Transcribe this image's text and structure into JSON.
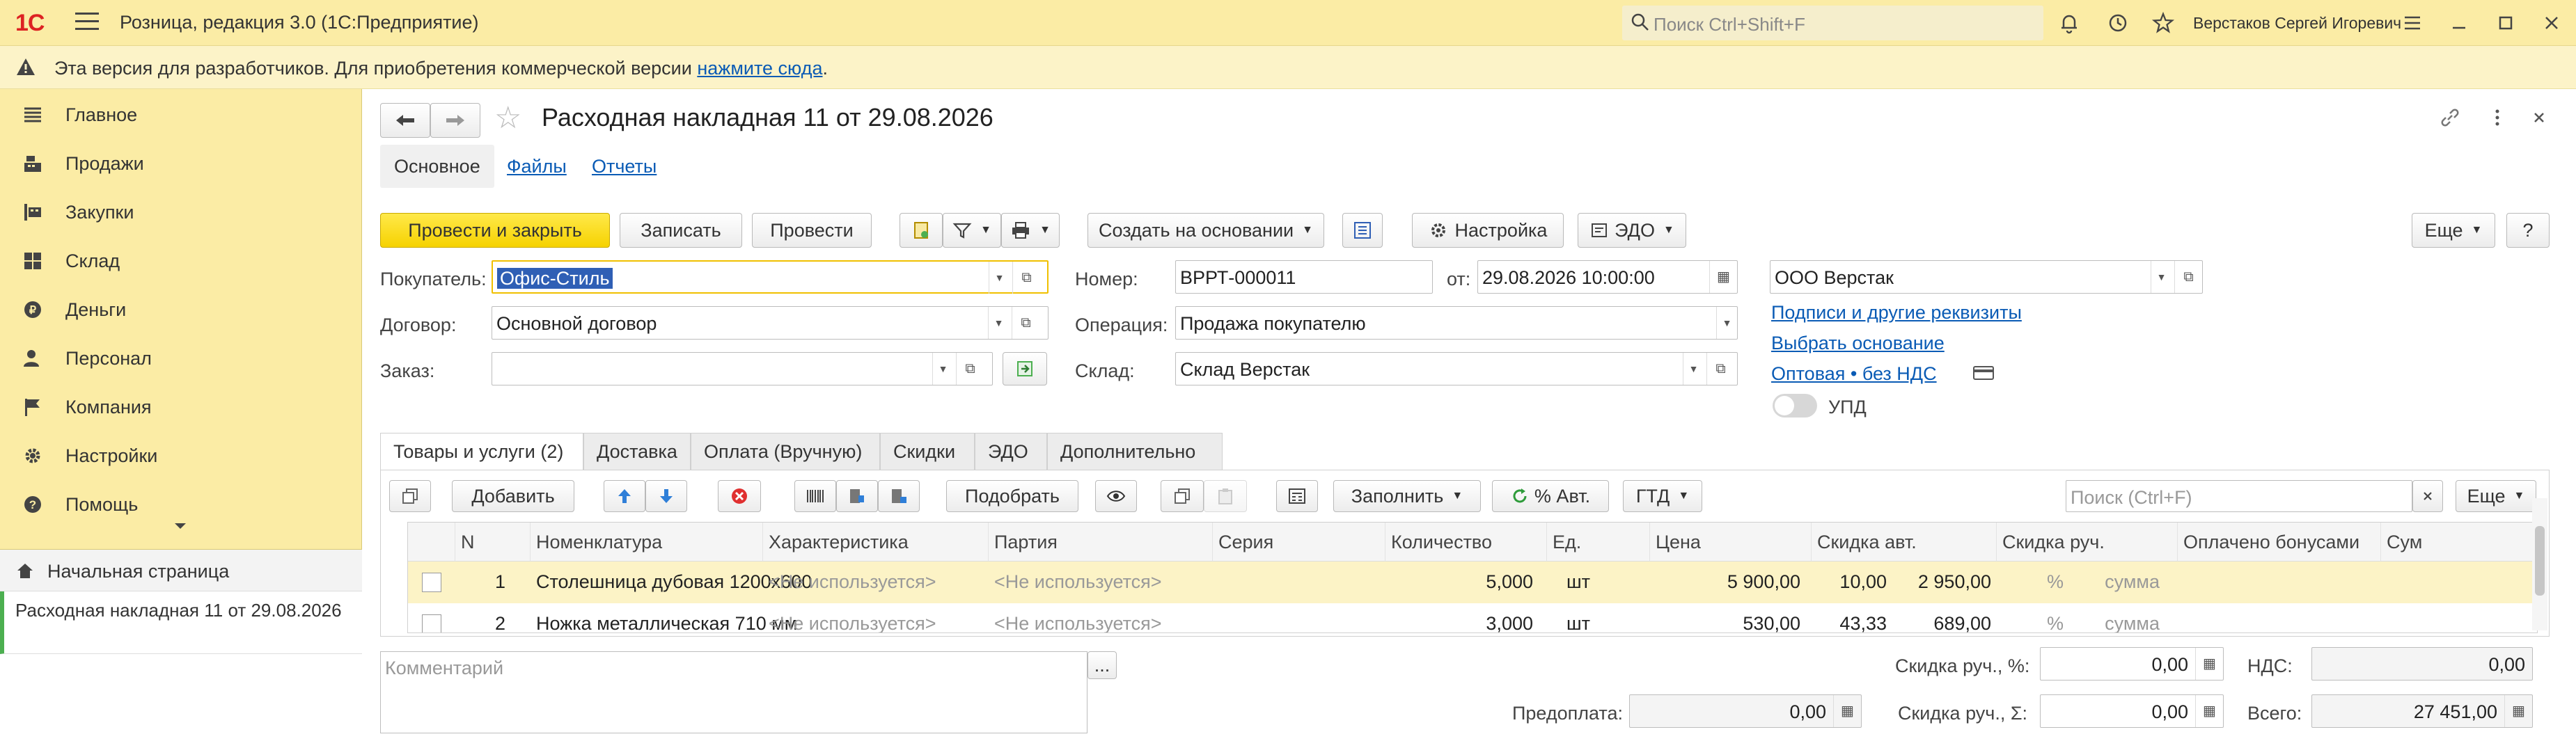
{
  "titlebar": {
    "logo": "1С",
    "app_title": "Розница, редакция 3.0  (1С:Предприятие)",
    "search_placeholder": "Поиск Ctrl+Shift+F",
    "user": "Верстаков Сергей Игоревич"
  },
  "infobar": {
    "text": "Эта версия для разработчиков. Для приобретения коммерческой версии ",
    "link": "нажмите сюда",
    "after": "."
  },
  "sidebar": {
    "items": [
      {
        "label": "Главное",
        "icon": "list-icon"
      },
      {
        "label": "Продажи",
        "icon": "cash-register-icon"
      },
      {
        "label": "Закупки",
        "icon": "cart-icon"
      },
      {
        "label": "Склад",
        "icon": "warehouse-icon"
      },
      {
        "label": "Деньги",
        "icon": "coin-icon"
      },
      {
        "label": "Персонал",
        "icon": "person-icon"
      },
      {
        "label": "Компания",
        "icon": "flag-icon"
      },
      {
        "label": "Настройки",
        "icon": "gear-icon"
      },
      {
        "label": "Помощь",
        "icon": "help-icon"
      }
    ],
    "home": "Начальная страница",
    "open_doc": "Расходная накладная 11 от 29.08.2026"
  },
  "doc": {
    "title": "Расходная накладная 11 от 29.08.2026",
    "tabs": [
      "Основное",
      "Файлы",
      "Отчеты"
    ]
  },
  "toolbar": {
    "post_close": "Провести и закрыть",
    "save": "Записать",
    "post": "Провести",
    "create_based": "Создать на основании",
    "settings": "Настройка",
    "edo": "ЭДО",
    "more": "Еще",
    "help": "?"
  },
  "form": {
    "buyer_label": "Покупатель:",
    "buyer_value": "Офис-Стиль",
    "contract_label": "Договор:",
    "contract_value": "Основной договор",
    "order_label": "Заказ:",
    "order_value": "",
    "number_label": "Номер:",
    "number_value": "ВРРТ-000011",
    "date_label": "от:",
    "date_value": "29.08.2026 10:00:00",
    "operation_label": "Операция:",
    "operation_value": "Продажа покупателю",
    "warehouse_label": "Склад:",
    "warehouse_value": "Склад Верстак",
    "org_value": "ООО Верстак",
    "link_signatures": "Подписи и другие реквизиты",
    "link_basis": "Выбрать основание",
    "link_price": "Оптовая • без НДС",
    "upd_label": "УПД"
  },
  "goods_tabs": [
    "Товары и услуги (2)",
    "Доставка",
    "Оплата (Вручную)",
    "Скидки",
    "ЭДО",
    "Дополнительно"
  ],
  "goods_toolbar": {
    "add": "Добавить",
    "pick": "Подобрать",
    "fill": "Заполнить",
    "auto_pct": "% Авт.",
    "gtd": "ГТД",
    "search_placeholder": "Поиск (Ctrl+F)",
    "more": "Еще"
  },
  "table": {
    "columns": [
      "N",
      "Номенклатура",
      "Характеристика",
      "Партия",
      "Серия",
      "Количество",
      "Ед.",
      "Цена",
      "Скидка авт.",
      "Скидка руч.",
      "Оплачено бонусами",
      "Сум"
    ],
    "rows": [
      {
        "n": "1",
        "name": "Столешница дубовая 1200х600",
        "char": "<Не используется>",
        "batch": "<Не используется>",
        "series": "",
        "qty": "5,000",
        "unit": "шт",
        "price": "5 900,00",
        "disc_auto_pct": "10,00",
        "disc_auto_sum": "2 950,00",
        "disc_man_pct": "%",
        "disc_man_sum": "сумма"
      },
      {
        "n": "2",
        "name": "Ножка металлическая 710 мм",
        "char": "<Не используется>",
        "batch": "<Не используется>",
        "series": "",
        "qty": "3,000",
        "unit": "шт",
        "price": "530,00",
        "disc_auto_pct": "43,33",
        "disc_auto_sum": "689,00",
        "disc_man_pct": "%",
        "disc_man_sum": "сумма"
      }
    ]
  },
  "footer": {
    "comment_placeholder": "Комментарий",
    "comment_btn": "...",
    "prepay_label": "Предоплата:",
    "prepay_value": "0,00",
    "disc_pct_label": "Скидка руч., %:",
    "disc_pct_value": "0,00",
    "disc_sum_label": "Скидка руч., Σ:",
    "disc_sum_value": "0,00",
    "vat_label": "НДС:",
    "vat_value": "0,00",
    "total_label": "Всего:",
    "total_value": "27 451,00"
  },
  "colors": {
    "accent_yellow": "#fbeca5",
    "primary_button": "#f6d200",
    "link": "#0a5bb5",
    "selected_row": "#fcf3c6"
  }
}
